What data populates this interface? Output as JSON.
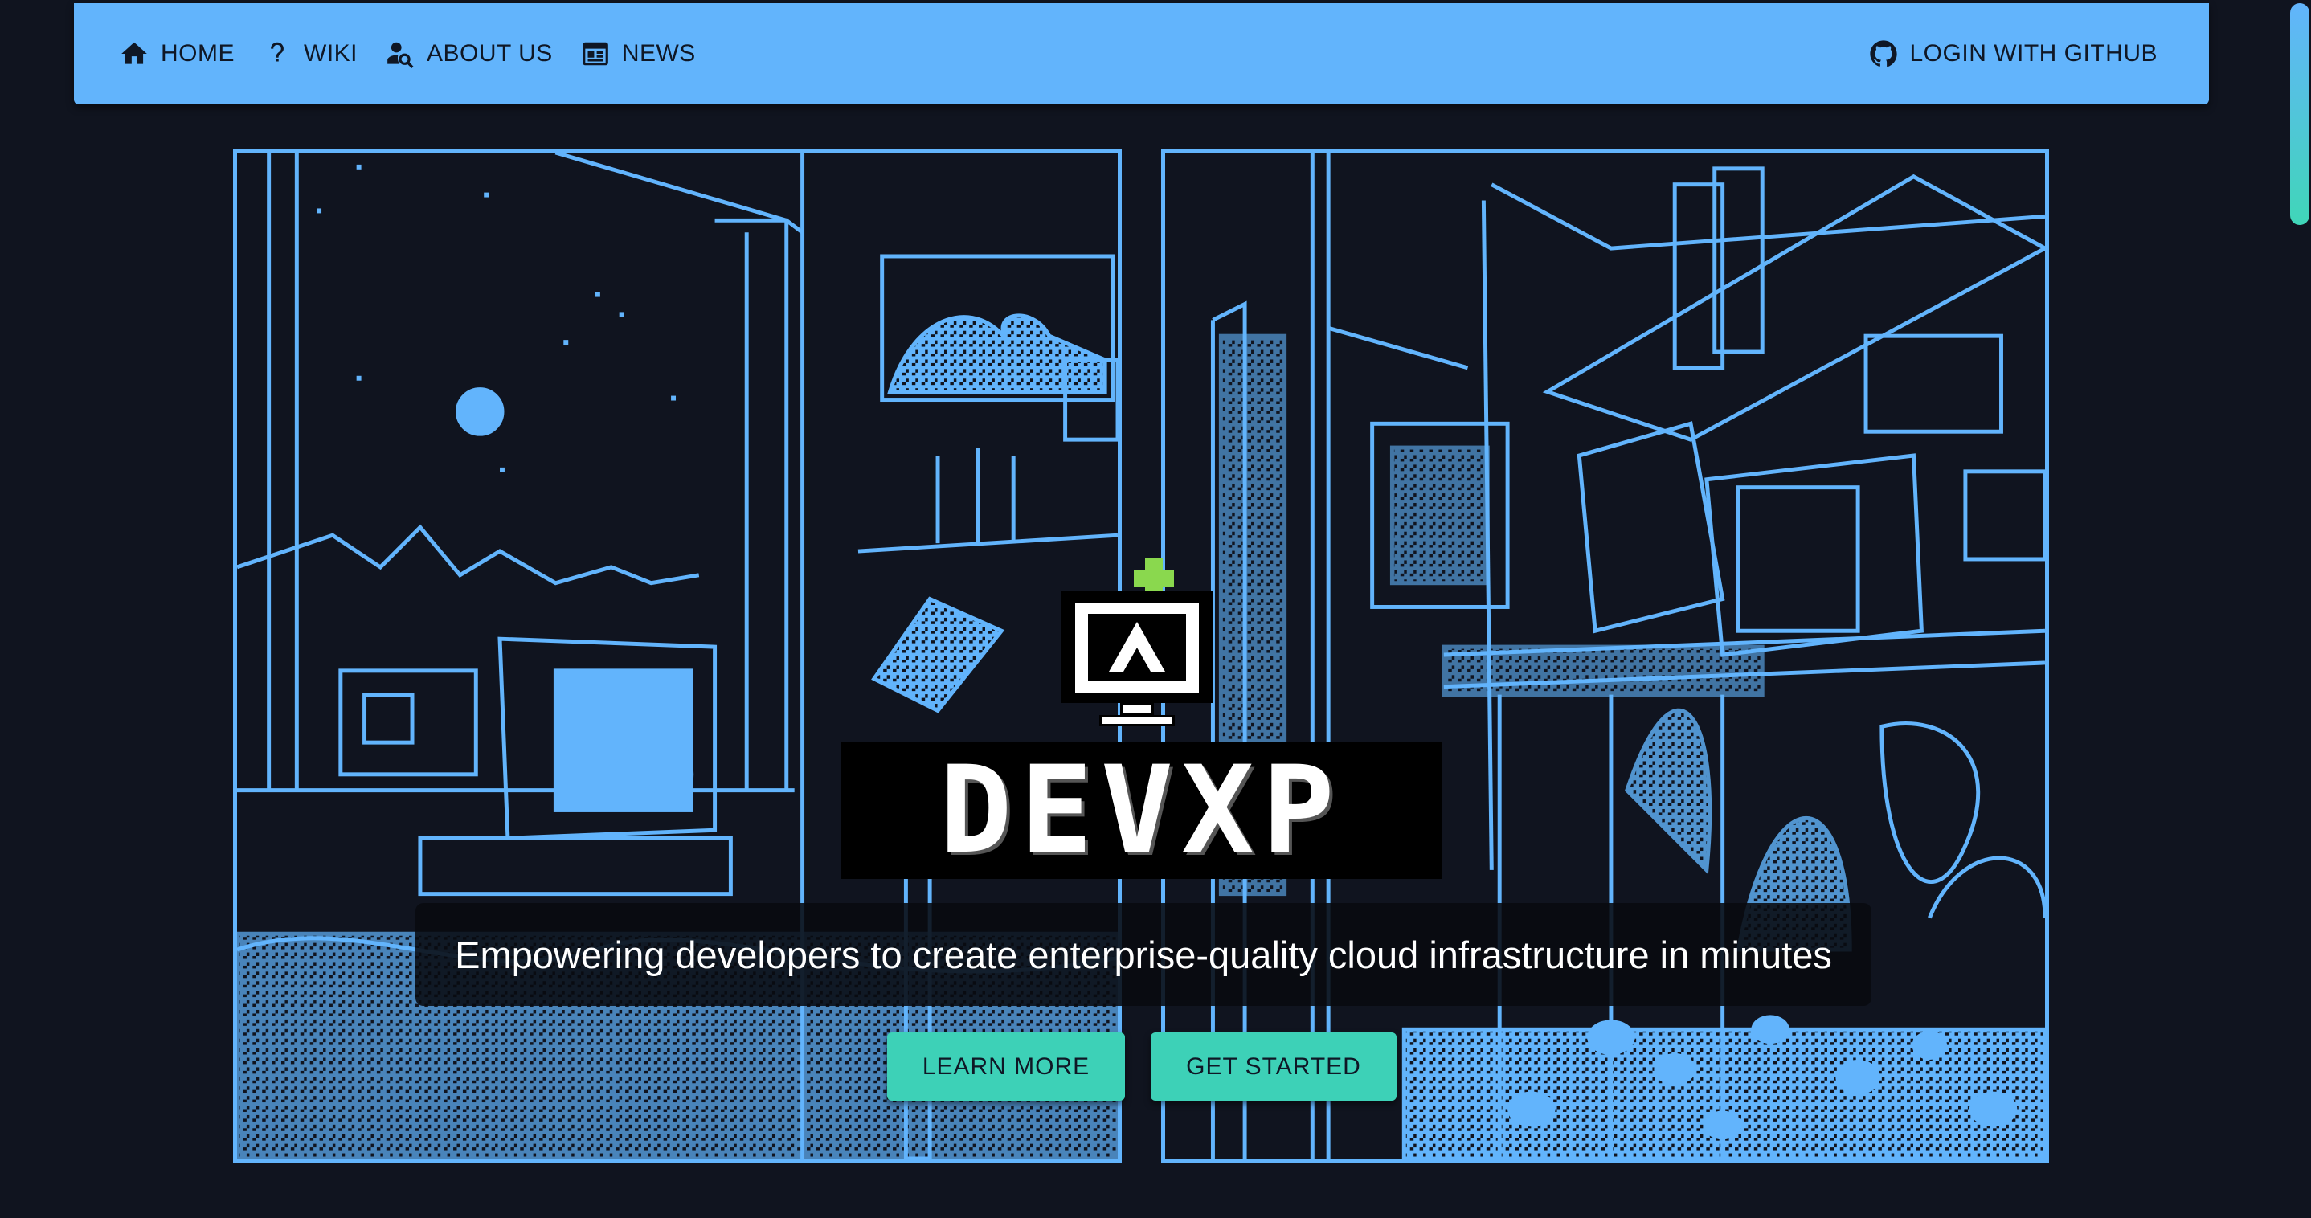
{
  "nav": {
    "items": [
      {
        "label": "HOME",
        "icon": "home-icon"
      },
      {
        "label": "WIKI",
        "icon": "question-icon"
      },
      {
        "label": "ABOUT US",
        "icon": "person-search-icon"
      },
      {
        "label": "NEWS",
        "icon": "newspaper-icon"
      }
    ],
    "login": {
      "label": "LOGIN WITH GITHUB",
      "icon": "github-icon"
    }
  },
  "hero": {
    "logo_text": "DEVXP",
    "tagline": "Empowering developers to create enterprise-quality cloud infrastructure in minutes",
    "buttons": {
      "learn_more": "LEARN MORE",
      "get_started": "GET STARTED"
    }
  },
  "colors": {
    "background": "#10141f",
    "nav": "#62b4fc",
    "line_art": "#62b4fc",
    "button": "#3dd1b7",
    "logo_accent": "#8ad84e"
  }
}
